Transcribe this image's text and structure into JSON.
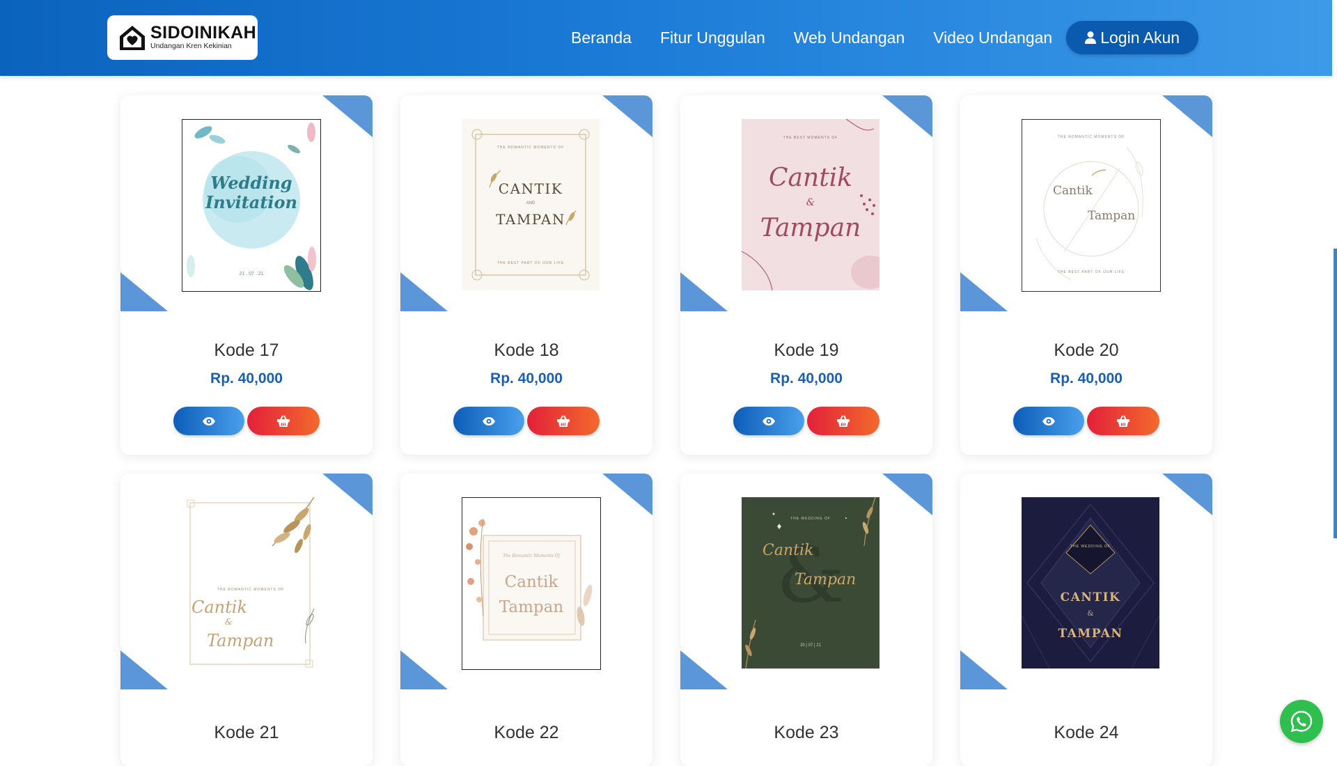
{
  "brand": {
    "name": "SIDOINIKAH",
    "tagline": "Undangan Kren Kekinian"
  },
  "nav": {
    "items": [
      "Beranda",
      "Fitur Unggulan",
      "Web Undangan",
      "Video Undangan"
    ],
    "login_label": "Login Akun"
  },
  "icons": {
    "login": "user-icon",
    "view": "eye-icon",
    "cart": "basket-icon",
    "chat": "whatsapp-icon"
  },
  "colors": {
    "header_start": "#0b63bd",
    "header_end": "#3d9ae9",
    "price": "#1a5fb0",
    "view_button": "#0c5db8",
    "cart_button": "#e3203a",
    "accent_triangle": "#5b96d9",
    "whatsapp": "#2fbf4f"
  },
  "products": [
    {
      "code": "Kode 17",
      "price": "Rp. 40,000",
      "thumb": {
        "line1": "Wedding",
        "line2": "Invitation",
        "date": "21 . 07 . 21"
      }
    },
    {
      "code": "Kode 18",
      "price": "Rp. 40,000",
      "thumb": {
        "top": "THE ROMANTIC MOMENTS OF",
        "line1": "CANTIK",
        "amp": "AND",
        "line2": "TAMPAN",
        "bottom": "THE BEST PART OF OUR LIFE"
      }
    },
    {
      "code": "Kode 19",
      "price": "Rp. 40,000",
      "thumb": {
        "top": "THE BEST MOMENTS OF",
        "line1": "Cantik",
        "amp": "&",
        "line2": "Tampan"
      }
    },
    {
      "code": "Kode 20",
      "price": "Rp. 40,000",
      "thumb": {
        "top": "THE ROMANTIC MOMENTS OF",
        "line1": "Cantik",
        "line2": "Tampan",
        "bottom": "THE BEST PART OF OUR LIFE"
      }
    },
    {
      "code": "Kode 21",
      "price": "",
      "thumb": {
        "top": "THE ROMANTIC MOMENTS OF",
        "line1": "Cantik",
        "amp": "&",
        "line2": "Tampan"
      }
    },
    {
      "code": "Kode 22",
      "price": "",
      "thumb": {
        "top": "The Romantic Moments Of",
        "line1": "Cantik",
        "line2": "Tampan"
      }
    },
    {
      "code": "Kode 23",
      "price": "",
      "thumb": {
        "top": "THE WEDDING OF",
        "line1": "Cantik",
        "line2": "Tampan",
        "date": "20 | 07 | 21"
      }
    },
    {
      "code": "Kode 24",
      "price": "",
      "thumb": {
        "top": "THE WEDDING OF",
        "line1": "CANTIK",
        "amp": "&",
        "line2": "TAMPAN"
      }
    }
  ]
}
